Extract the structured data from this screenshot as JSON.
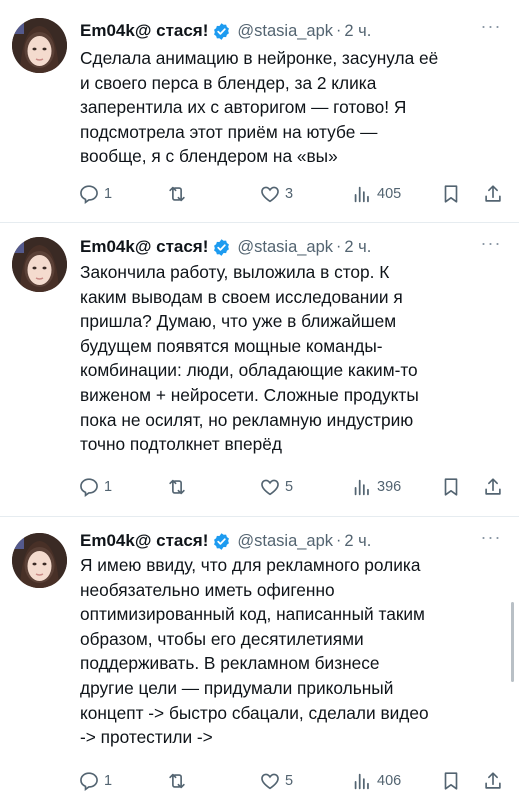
{
  "tweets": [
    {
      "name": "Em04k@ стася!",
      "handle": "@stasia_apk",
      "separator": "·",
      "time": "2 ч.",
      "more_label": "···",
      "lines": [
        "Сделала анимацию в нейронке, засунула её",
        "и своего перса в блендер, за 2 клика",
        "заперентила их с авторигом — готово! Я",
        "подсмотрела этот приём на ютубе —",
        "вообще, я с блендером на «вы»"
      ],
      "replies": "1",
      "retweets": "",
      "likes": "3",
      "views": "405"
    },
    {
      "name": "Em04k@ стася!",
      "handle": "@stasia_apk",
      "separator": "·",
      "time": "2 ч.",
      "more_label": "···",
      "lines": [
        "Закончила работу, выложила в стор. К",
        "каким выводам в своем исследовании я",
        "пришла? Думаю, что уже в ближайшем",
        "будущем появятся мощные команды-",
        "комбинации: люди, обладающие каким-то",
        "виженом + нейросети. Сложные продукты",
        "пока не осилят, но рекламную индустрию",
        "точно подтолкнет вперёд"
      ],
      "replies": "1",
      "retweets": "",
      "likes": "5",
      "views": "396"
    },
    {
      "name": "Em04k@ стася!",
      "handle": "@stasia_apk",
      "separator": "·",
      "time": "2 ч.",
      "more_label": "···",
      "lines": [
        "Я имею ввиду, что для рекламного ролика",
        "необязательно иметь офигенно",
        "оптимизированный код, написанный таким",
        "образом, чтобы его десятилетиями",
        "поддерживать. В рекламном бизнесе",
        "другие цели — придумали прикольный",
        "концепт -> быстро сбацали, сделали видео",
        "-> протестили ->"
      ],
      "replies": "1",
      "retweets": "",
      "likes": "5",
      "views": "406"
    }
  ],
  "colors": {
    "text": "#0f1419",
    "secondary": "#536471",
    "verified": "#1d9bf0",
    "divider": "#e6ecf0"
  },
  "icons": [
    "verified-badge-icon",
    "more-icon",
    "reply-icon",
    "retweet-icon",
    "like-icon",
    "views-icon",
    "bookmark-icon",
    "share-icon"
  ]
}
